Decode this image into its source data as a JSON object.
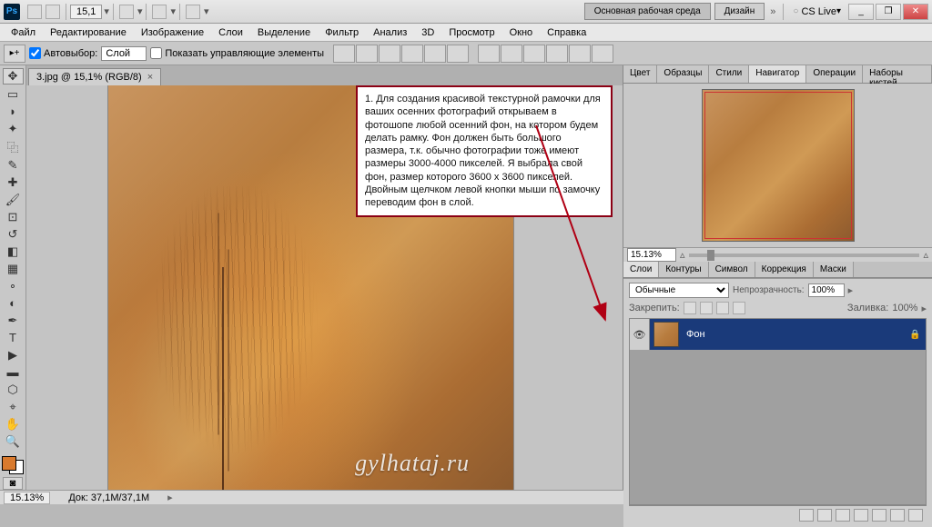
{
  "titlebar": {
    "zoom_display": "15,1",
    "ws_main": "Основная рабочая среда",
    "ws_design": "Дизайн",
    "cslive": "CS Live",
    "min": "_",
    "max": "❐",
    "close": "✕"
  },
  "menu": {
    "file": "Файл",
    "edit": "Редактирование",
    "image": "Изображение",
    "layer": "Слои",
    "select": "Выделение",
    "filter": "Фильтр",
    "analysis": "Анализ",
    "three_d": "3D",
    "view": "Просмотр",
    "window": "Окно",
    "help": "Справка"
  },
  "options": {
    "auto_select": "Автовыбор:",
    "auto_select_mode": "Слой",
    "show_controls": "Показать управляющие элементы"
  },
  "document": {
    "tab_title": "3.jpg @ 15,1% (RGB/8)",
    "watermark": "gylhataj.ru"
  },
  "note": {
    "text": "1. Для создания красивой текстурной рамочки для ваших осенних фотографий открываем в фотошопе любой осенний фон, на котором будем делать рамку. Фон должен быть большого размера, т.к. обычно фотографии тоже имеют размеры 3000-4000 пикселей. Я выбрала свой фон, размер которого 3600 x 3600 пикселей. Двойным щелчком левой кнопки мыши по замочку переводим фон в слой."
  },
  "panels": {
    "top_tabs": {
      "color": "Цвет",
      "swatches": "Образцы",
      "styles": "Стили",
      "navigator": "Навигатор",
      "actions": "Операции",
      "brushes": "Наборы кистей"
    },
    "nav_zoom": "15.13%",
    "layer_tabs": {
      "layers": "Слои",
      "paths": "Контуры",
      "info": "Символ",
      "adjust": "Коррекция",
      "masks": "Маски"
    },
    "blend_mode": "Обычные",
    "opacity_label": "Непрозрачность:",
    "opacity_val": "100%",
    "lock_label": "Закрепить:",
    "fill_label": "Заливка:",
    "fill_val": "100%",
    "layer0_name": "Фон"
  },
  "status": {
    "zoom": "15.13%",
    "doc": "Док: 37,1M/37,1M"
  }
}
